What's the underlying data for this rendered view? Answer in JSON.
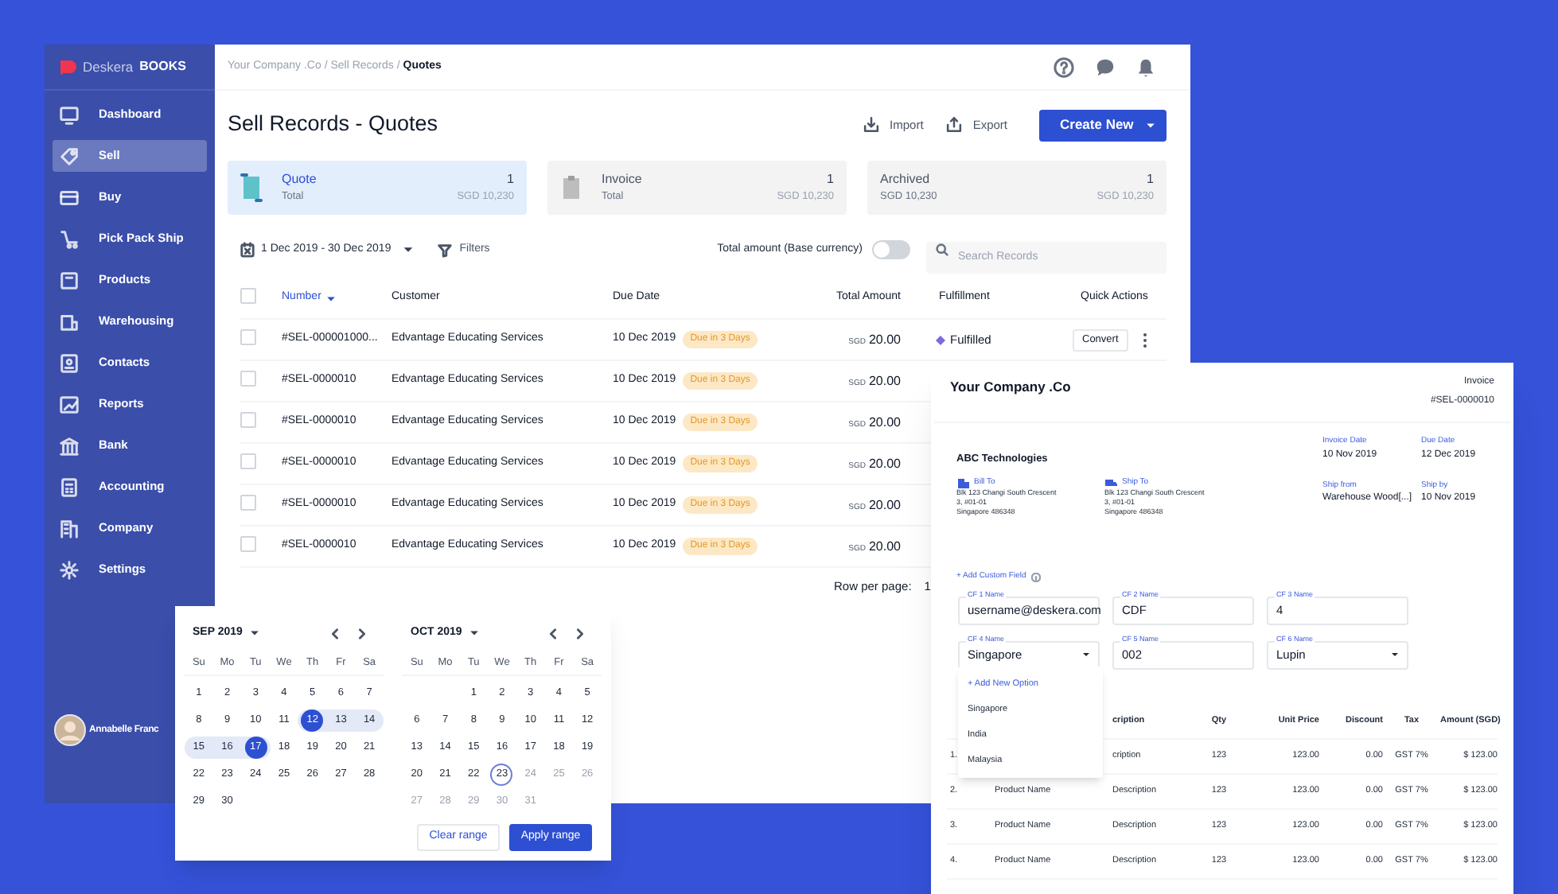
{
  "sidebar": {
    "brand": "Deskera",
    "product": "BOOKS",
    "items": [
      {
        "label": "Dashboard",
        "selected": false
      },
      {
        "label": "Sell",
        "selected": true
      },
      {
        "label": "Buy",
        "selected": false
      },
      {
        "label": "Pick Pack Ship",
        "selected": false
      },
      {
        "label": "Products",
        "selected": false
      },
      {
        "label": "Warehousing",
        "selected": false
      },
      {
        "label": "Contacts",
        "selected": false
      },
      {
        "label": "Reports",
        "selected": false
      },
      {
        "label": "Bank",
        "selected": false
      },
      {
        "label": "Accounting",
        "selected": false
      },
      {
        "label": "Company",
        "selected": false
      },
      {
        "label": "Settings",
        "selected": false
      }
    ],
    "user": {
      "name": "Annabelle Franc"
    }
  },
  "header": {
    "breadcrumb_path": "Your Company .Co / Sell Records /",
    "breadcrumb_current": "Quotes"
  },
  "page": {
    "title": "Sell Records - Quotes",
    "actions": [
      "Import",
      "Export"
    ],
    "primary_action": "Create New"
  },
  "summary_cards": [
    {
      "title": "Quote",
      "subtitle": "Total",
      "count": "1",
      "amount": "SGD 10,230",
      "selected": true
    },
    {
      "title": "Invoice",
      "subtitle": "Total",
      "count": "1",
      "amount": "SGD 10,230",
      "selected": false
    },
    {
      "title": "Archived",
      "subtitle": "SGD 10,230",
      "count": "1",
      "amount": "SGD 10,230",
      "selected": false
    }
  ],
  "toolbar": {
    "date_range": "1 Dec 2019 - 30 Dec 2019",
    "filters": "Filters",
    "toggle_label": "Total amount (Base currency)",
    "toggle_on": false,
    "search_placeholder": "Search Records"
  },
  "table": {
    "all_checked": false,
    "columns": [
      {
        "label": "Number",
        "sorted": true
      },
      {
        "label": "Customer",
        "sorted": false
      },
      {
        "label": "Due Date",
        "sorted": false
      },
      {
        "label": "Total Amount",
        "sorted": false
      },
      {
        "label": "Fulfillment",
        "sorted": false
      },
      {
        "label": "Quick Actions",
        "sorted": false
      }
    ],
    "rows": [
      {
        "checked": false,
        "number": "#SEL-000001000...",
        "customer": "Edvantage Educating Services",
        "due_date": "10 Dec 2019",
        "due_badge": "Due in 3 Days",
        "currency": "SGD",
        "amount": "20.00",
        "fulfillment": "Fulfilled",
        "action": "Convert"
      },
      {
        "checked": false,
        "number": "#SEL-0000010",
        "customer": "Edvantage Educating Services",
        "due_date": "10 Dec 2019",
        "due_badge": "Due in 3 Days",
        "currency": "SGD",
        "amount": "20.00"
      },
      {
        "checked": false,
        "number": "#SEL-0000010",
        "customer": "Edvantage Educating Services",
        "due_date": "10 Dec 2019",
        "due_badge": "Due in 3 Days",
        "currency": "SGD",
        "amount": "20.00"
      },
      {
        "checked": false,
        "number": "#SEL-0000010",
        "customer": "Edvantage Educating Services",
        "due_date": "10 Dec 2019",
        "due_badge": "Due in 3 Days",
        "currency": "SGD",
        "amount": "20.00"
      },
      {
        "checked": false,
        "number": "#SEL-0000010",
        "customer": "Edvantage Educating Services",
        "due_date": "10 Dec 2019",
        "due_badge": "Due in 3 Days",
        "currency": "SGD",
        "amount": "20.00"
      },
      {
        "checked": false,
        "number": "#SEL-0000010",
        "customer": "Edvantage Educating Services",
        "due_date": "10 Dec 2019",
        "due_badge": "Due in 3 Days",
        "currency": "SGD",
        "amount": "20.00"
      }
    ],
    "rows_per_page_label": "Row per page:",
    "rows_per_page_value": "1"
  },
  "calendar": {
    "months": [
      {
        "title": "SEP 2019",
        "weekdays": [
          "Su",
          "Mo",
          "Tu",
          "We",
          "Th",
          "Fr",
          "Sa"
        ],
        "weeks": [
          [
            {
              "label": "1",
              "kind": "normal"
            },
            {
              "label": "2",
              "kind": "normal"
            },
            {
              "label": "3",
              "kind": "normal"
            },
            {
              "label": "4",
              "kind": "normal"
            },
            {
              "label": "5",
              "kind": "normal"
            },
            {
              "label": "6",
              "kind": "normal"
            },
            {
              "label": "7",
              "kind": "normal"
            }
          ],
          [
            {
              "label": "8",
              "kind": "normal"
            },
            {
              "label": "9",
              "kind": "normal"
            },
            {
              "label": "10",
              "kind": "normal"
            },
            {
              "label": "11",
              "kind": "normal"
            },
            {
              "label": "12",
              "kind": "range_start"
            },
            {
              "label": "13",
              "kind": "in_range"
            },
            {
              "label": "14",
              "kind": "in_range"
            }
          ],
          [
            {
              "label": "15",
              "kind": "in_range"
            },
            {
              "label": "16",
              "kind": "in_range"
            },
            {
              "label": "17",
              "kind": "range_end"
            },
            {
              "label": "18",
              "kind": "normal"
            },
            {
              "label": "19",
              "kind": "normal"
            },
            {
              "label": "20",
              "kind": "normal"
            },
            {
              "label": "21",
              "kind": "normal"
            }
          ],
          [
            {
              "label": "22",
              "kind": "normal"
            },
            {
              "label": "23",
              "kind": "normal"
            },
            {
              "label": "24",
              "kind": "normal"
            },
            {
              "label": "25",
              "kind": "normal"
            },
            {
              "label": "26",
              "kind": "normal"
            },
            {
              "label": "27",
              "kind": "normal"
            },
            {
              "label": "28",
              "kind": "normal"
            }
          ],
          [
            {
              "label": "29",
              "kind": "normal"
            },
            {
              "label": "30",
              "kind": "normal"
            }
          ]
        ]
      },
      {
        "title": "OCT 2019",
        "weekdays": [
          "Su",
          "Mo",
          "Tu",
          "We",
          "Th",
          "Fr",
          "Sa"
        ],
        "weeks": [
          [
            {
              "kind": "blank"
            },
            {
              "kind": "blank"
            },
            {
              "label": "1",
              "kind": "normal"
            },
            {
              "label": "2",
              "kind": "normal"
            },
            {
              "label": "3",
              "kind": "normal"
            },
            {
              "label": "4",
              "kind": "normal"
            },
            {
              "label": "5",
              "kind": "normal"
            }
          ],
          [
            {
              "label": "6",
              "kind": "normal"
            },
            {
              "label": "7",
              "kind": "normal"
            },
            {
              "label": "8",
              "kind": "normal"
            },
            {
              "label": "9",
              "kind": "normal"
            },
            {
              "label": "10",
              "kind": "normal"
            },
            {
              "label": "11",
              "kind": "normal"
            },
            {
              "label": "12",
              "kind": "normal"
            }
          ],
          [
            {
              "label": "13",
              "kind": "normal"
            },
            {
              "label": "14",
              "kind": "normal"
            },
            {
              "label": "15",
              "kind": "normal"
            },
            {
              "label": "16",
              "kind": "normal"
            },
            {
              "label": "17",
              "kind": "normal"
            },
            {
              "label": "18",
              "kind": "normal"
            },
            {
              "label": "19",
              "kind": "normal"
            }
          ],
          [
            {
              "label": "20",
              "kind": "normal"
            },
            {
              "label": "21",
              "kind": "normal"
            },
            {
              "label": "22",
              "kind": "normal"
            },
            {
              "label": "23",
              "kind": "today"
            },
            {
              "label": "24",
              "kind": "disabled"
            },
            {
              "label": "25",
              "kind": "disabled"
            },
            {
              "label": "26",
              "kind": "disabled"
            }
          ],
          [
            {
              "label": "27",
              "kind": "disabled"
            },
            {
              "label": "28",
              "kind": "disabled"
            },
            {
              "label": "29",
              "kind": "disabled"
            },
            {
              "label": "30",
              "kind": "disabled"
            },
            {
              "label": "31",
              "kind": "disabled"
            }
          ]
        ]
      }
    ],
    "buttons": [
      "Clear range",
      "Apply range"
    ]
  },
  "invoice": {
    "company": "Your Company .Co",
    "doc_type": "Invoice",
    "doc_number": "#SEL-0000010",
    "customer": "ABC Technologies",
    "addresses": [
      {
        "label": "Bill To",
        "lines": [
          "Blk 123 Changi South Crescent",
          "3, #01-01",
          "Singapore 486348"
        ]
      },
      {
        "label": "Ship To",
        "lines": [
          "Blk 123 Changi South Crescent",
          "3, #01-01",
          "Singapore 486348"
        ]
      }
    ],
    "meta": [
      {
        "label": "Invoice Date",
        "value": "10 Nov 2019"
      },
      {
        "label": "Due Date",
        "value": "12 Dec 2019"
      },
      {
        "label": "Ship from",
        "value": "Warehouse Wood[...]"
      },
      {
        "label": "Ship by",
        "value": "10 Nov 2019"
      }
    ],
    "add_custom_field": "+ Add Custom Field",
    "custom_fields": [
      {
        "label": "CF 1 Name",
        "value": "username@deskera.com",
        "kind": "text"
      },
      {
        "label": "CF 2 Name",
        "value": "CDF",
        "kind": "text"
      },
      {
        "label": "CF 3 Name",
        "value": "4",
        "kind": "text"
      },
      {
        "label": "CF 4 Name",
        "value": "Singapore",
        "kind": "select"
      },
      {
        "label": "CF 5 Name",
        "value": "002",
        "kind": "text"
      },
      {
        "label": "CF 6 Name",
        "value": "Lupin",
        "kind": "select"
      }
    ],
    "dropdown_options": [
      {
        "label": "+ Add New Option",
        "kind": "action"
      },
      {
        "label": "Singapore",
        "kind": "option"
      },
      {
        "label": "India",
        "kind": "option"
      },
      {
        "label": "Malaysia",
        "kind": "option"
      }
    ],
    "item_columns": [
      "cription",
      "Qty",
      "Unit Price",
      "Discount",
      "Tax",
      "Amount (SGD)"
    ],
    "items": [
      {
        "number": "1.",
        "description": "cription",
        "qty": "123",
        "unit_price": "123.00",
        "discount": "0.00",
        "tax": "GST 7%",
        "amount": "$ 123.00"
      },
      {
        "number": "2.",
        "product": "Product Name",
        "description": "Description",
        "qty": "123",
        "unit_price": "123.00",
        "discount": "0.00",
        "tax": "GST 7%",
        "amount": "$ 123.00"
      },
      {
        "number": "3.",
        "product": "Product Name",
        "description": "Description",
        "qty": "123",
        "unit_price": "123.00",
        "discount": "0.00",
        "tax": "GST 7%",
        "amount": "$ 123.00"
      },
      {
        "number": "4.",
        "product": "Product Name",
        "description": "Description",
        "qty": "123",
        "unit_price": "123.00",
        "discount": "0.00",
        "tax": "GST 7%",
        "amount": "$ 123.00"
      }
    ]
  }
}
